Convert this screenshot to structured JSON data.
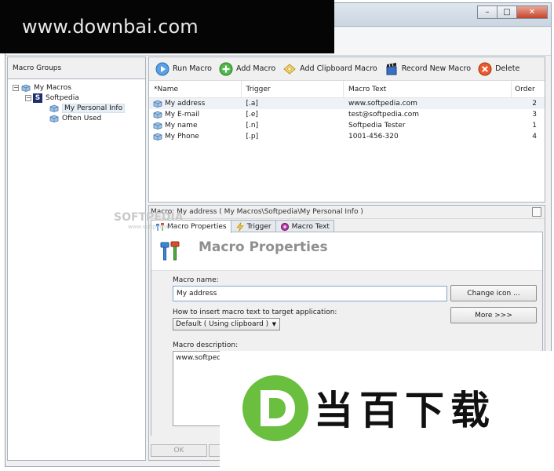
{
  "watermark": {
    "site": "www.downbai.com",
    "ghost_brand": "SOFTPEDIA",
    "ghost_sub": "www.softpedia.com"
  },
  "window": {
    "min": "–",
    "max": "□",
    "close": "✕"
  },
  "left_panel": {
    "caption": "Macro Groups",
    "tree": [
      {
        "label": "My Macros",
        "level": 0,
        "expander": "−"
      },
      {
        "label": "Softpedia",
        "level": 1,
        "expander": "−"
      },
      {
        "label": "My Personal Info",
        "level": 2,
        "selected": true
      },
      {
        "label": "Often Used",
        "level": 2
      }
    ]
  },
  "toolbar": {
    "run": "Run Macro",
    "add": "Add Macro",
    "add_clip": "Add Clipboard Macro",
    "record": "Record New Macro",
    "delete": "Delete"
  },
  "grid": {
    "headers": [
      "*Name",
      "Trigger",
      "Macro Text",
      "Order"
    ],
    "rows": [
      {
        "name": "My address",
        "trigger": "[.a]",
        "text": "www.softpedia.com",
        "order": "2"
      },
      {
        "name": "My E-mail",
        "trigger": "[.e]",
        "text": "test@softpedia.com",
        "order": "3"
      },
      {
        "name": "My name",
        "trigger": "[.n]",
        "text": "Softpedia Tester",
        "order": "1"
      },
      {
        "name": "My Phone",
        "trigger": "[.p]",
        "text": "1001-456-320",
        "order": "4"
      }
    ]
  },
  "detail": {
    "header": "Macro: My address ( My Macros\\Softpedia\\My Personal Info )",
    "tabs": [
      "Macro Properties",
      "Trigger",
      "Macro Text"
    ],
    "title": "Macro Properties",
    "name_label": "Macro name:",
    "name_value": "My address",
    "change_icon": "Change icon ...",
    "insert_label": "How to insert macro text to target application:",
    "insert_value": "Default ( Using clipboard )",
    "more": "More >>>",
    "desc_label": "Macro description:",
    "desc_value": "www.softpedia.",
    "ok": "OK"
  },
  "logo": {
    "letter": "D",
    "text": "当百下载"
  },
  "colors": {
    "logo_green": "#6abf3e",
    "accent_blue": "#3b7fd1"
  }
}
